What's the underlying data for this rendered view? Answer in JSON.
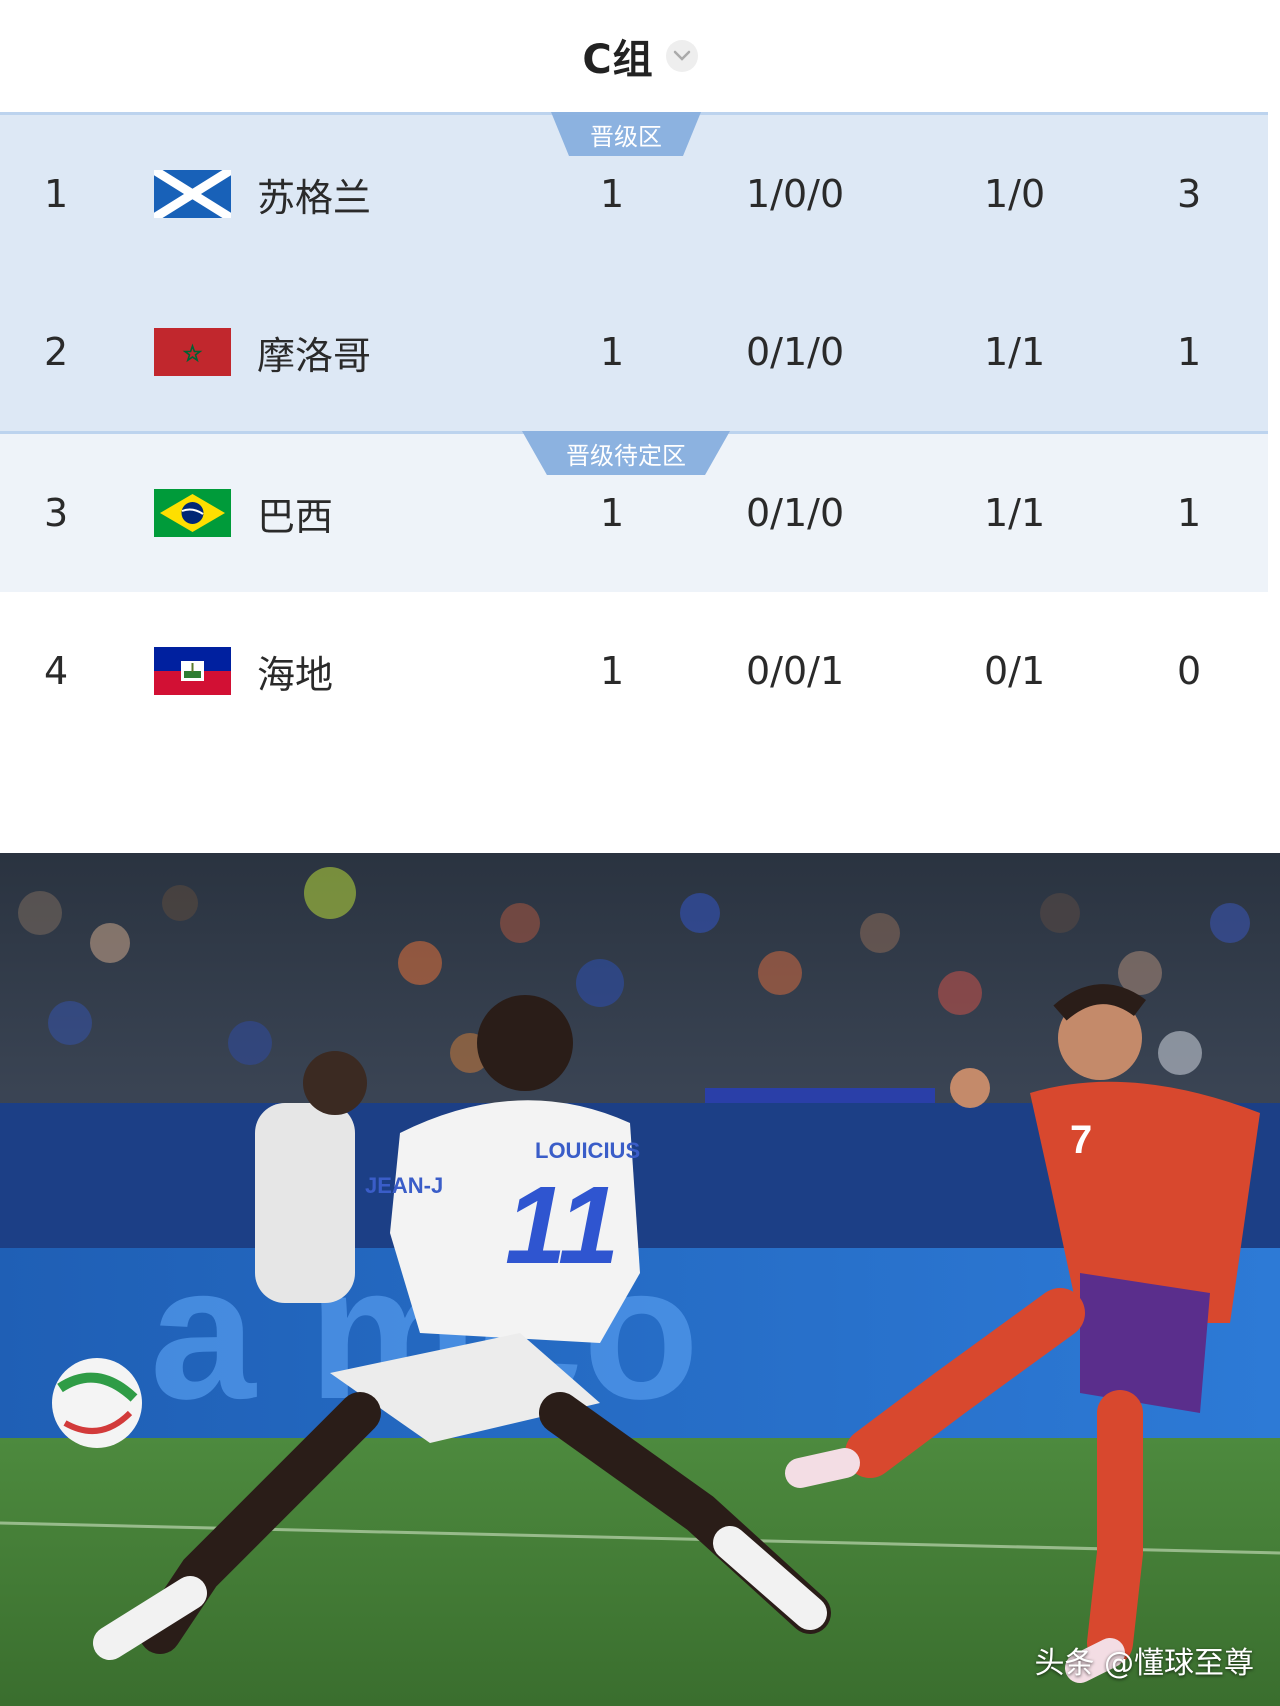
{
  "group": {
    "title": "C组"
  },
  "zones": {
    "promotion_label": "晋级区",
    "pending_label": "晋级待定区"
  },
  "standings": [
    {
      "rank": "1",
      "team": "苏格兰",
      "flag": "scotland-flag-icon",
      "played": "1",
      "wdl": "1/0/0",
      "goals": "1/0",
      "points": "3"
    },
    {
      "rank": "2",
      "team": "摩洛哥",
      "flag": "morocco-flag-icon",
      "played": "1",
      "wdl": "0/1/0",
      "goals": "1/1",
      "points": "1"
    },
    {
      "rank": "3",
      "team": "巴西",
      "flag": "brazil-flag-icon",
      "played": "1",
      "wdl": "0/1/0",
      "goals": "1/1",
      "points": "1"
    },
    {
      "rank": "4",
      "team": "海地",
      "flag": "haiti-flag-icon",
      "played": "1",
      "wdl": "0/0/1",
      "goals": "0/1",
      "points": "0"
    }
  ],
  "photo": {
    "jersey_name_white_11": "LOUICIUS",
    "jersey_number_white": "11",
    "jersey_name_white_left": "JEAN-J",
    "jersey_number_red": "7",
    "watermark": "头条 @懂球至尊"
  },
  "colors": {
    "promotion_bg": "#dde8f5",
    "pending_bg": "#eef3f9",
    "zone_tag": "#8cb2e0",
    "pitch_green": "#3f7a34"
  }
}
